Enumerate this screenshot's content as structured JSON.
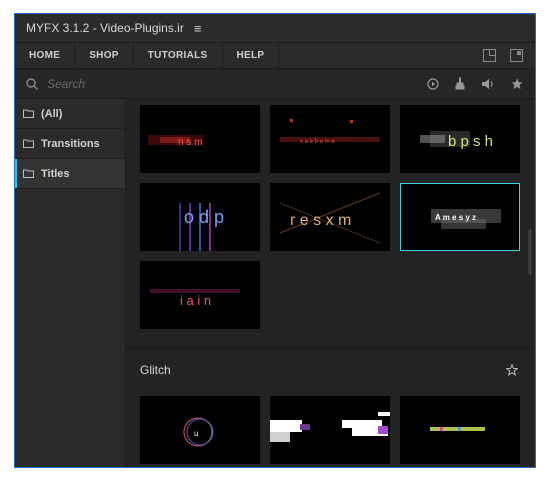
{
  "titlebar": {
    "title": "MYFX 3.1.2 - Video-Plugins.ir",
    "menu_glyph": "≡"
  },
  "nav": {
    "items": [
      "HOME",
      "SHOP",
      "TUTORIALS",
      "HELP"
    ]
  },
  "search": {
    "placeholder": "Search",
    "value": ""
  },
  "sidebar": {
    "items": [
      {
        "label": "(All)",
        "active": false
      },
      {
        "label": "Transitions",
        "active": false
      },
      {
        "label": "Titles",
        "active": true
      }
    ]
  },
  "content": {
    "titles_thumbs": [
      {
        "text": "n s m"
      },
      {
        "text": "x a e b e m e"
      },
      {
        "text": "b p s   h"
      },
      {
        "text": "o d p"
      },
      {
        "text": "r e s x m"
      },
      {
        "text": "A m e s y z",
        "selected": true
      },
      {
        "text": "i a i n"
      }
    ],
    "section_title": "Glitch",
    "glitch_thumbs": [
      {
        "text": "u"
      },
      {
        "text": ""
      },
      {
        "text": ""
      }
    ]
  },
  "colors": {
    "accent": "#31c6d4",
    "window_border": "#1f6fd6",
    "background": "#232323"
  },
  "icons": [
    "menu-icon",
    "minimize-icon",
    "maximize-icon",
    "search-icon",
    "play-icon",
    "usb-icon",
    "volume-icon",
    "star-icon",
    "folder-icon",
    "star-outline-icon"
  ]
}
